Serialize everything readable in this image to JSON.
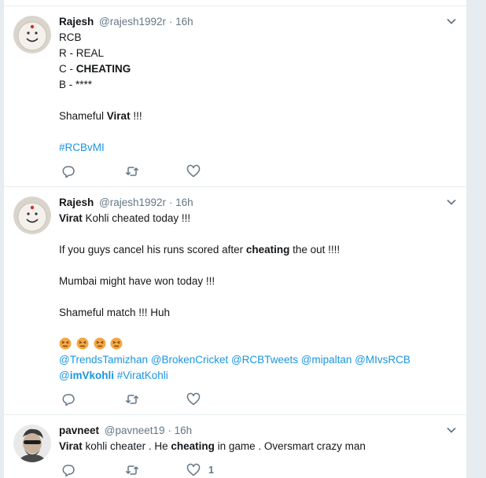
{
  "tweets": [
    {
      "name": "Rajesh",
      "handle": "@rajesh1992r",
      "dot": "·",
      "time": "16h",
      "text": {
        "l1": "RCB",
        "l2": "R - REAL",
        "l3a": "C - ",
        "l3b": "CHEATING",
        "l4": "B - ****",
        "l5a": "Shameful ",
        "l5b": "Virat",
        "l5c": " !!!",
        "hashtag": "#RCBvMI"
      },
      "likes": ""
    },
    {
      "name": "Rajesh",
      "handle": "@rajesh1992r",
      "dot": "·",
      "time": "16h",
      "text": {
        "l1a": "Virat",
        "l1b": " Kohli cheated today !!!",
        "l2a": "If you guys cancel his runs scored after ",
        "l2b": "cheating",
        "l2c": " the out !!!!",
        "l3": "Mumbai might have won today !!!",
        "l4": "Shameful match !!! Huh",
        "mentions1": "@TrendsTamizhan @BrokenCricket @RCBTweets @mipaltan @MIvsRCB",
        "mention2a": "@",
        "mention2b": "imVkohli",
        "mention2c": " #ViratKohli"
      },
      "likes": ""
    },
    {
      "name": "pavneet",
      "handle": "@pavneet19",
      "dot": "·",
      "time": "16h",
      "text": {
        "l1a": "Virat",
        "l1b": " kohli cheater . He ",
        "l1c": "cheating",
        "l1d": " in game . Oversmart crazy man"
      },
      "likes": "1"
    }
  ],
  "colors": {
    "link": "#1b95e0",
    "muted": "#657786",
    "border": "#e6ecf0",
    "emoji": "#f4a742"
  },
  "icons": [
    "reply-icon",
    "retweet-icon",
    "like-icon",
    "chevron-down-icon",
    "persevering-face-emoji"
  ]
}
